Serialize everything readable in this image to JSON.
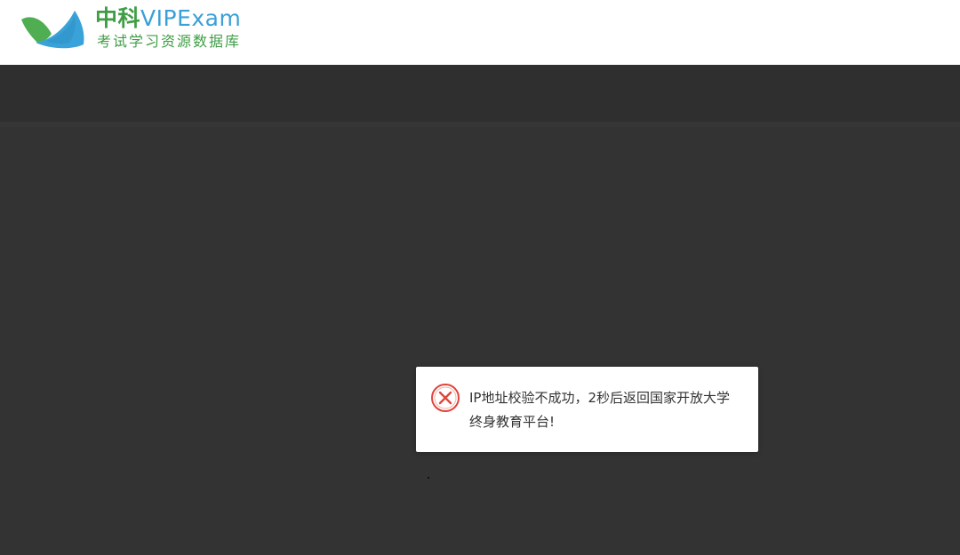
{
  "header": {
    "logo": {
      "title_cn": "中科",
      "title_en": "VIPExam",
      "subtitle": "考试学习资源数据库",
      "colors": {
        "green": "#3f9e45",
        "blue": "#3aa0d6"
      }
    }
  },
  "dialog": {
    "icon": "error-circle-x-icon",
    "icon_color": "#e0453a",
    "message": "IP地址校验不成功，2秒后返回国家开放大学终身教育平台!"
  },
  "colors": {
    "header_bg": "#ffffff",
    "overlay_bg": "#333333",
    "nav_band_bg": "#2f2f2f"
  }
}
